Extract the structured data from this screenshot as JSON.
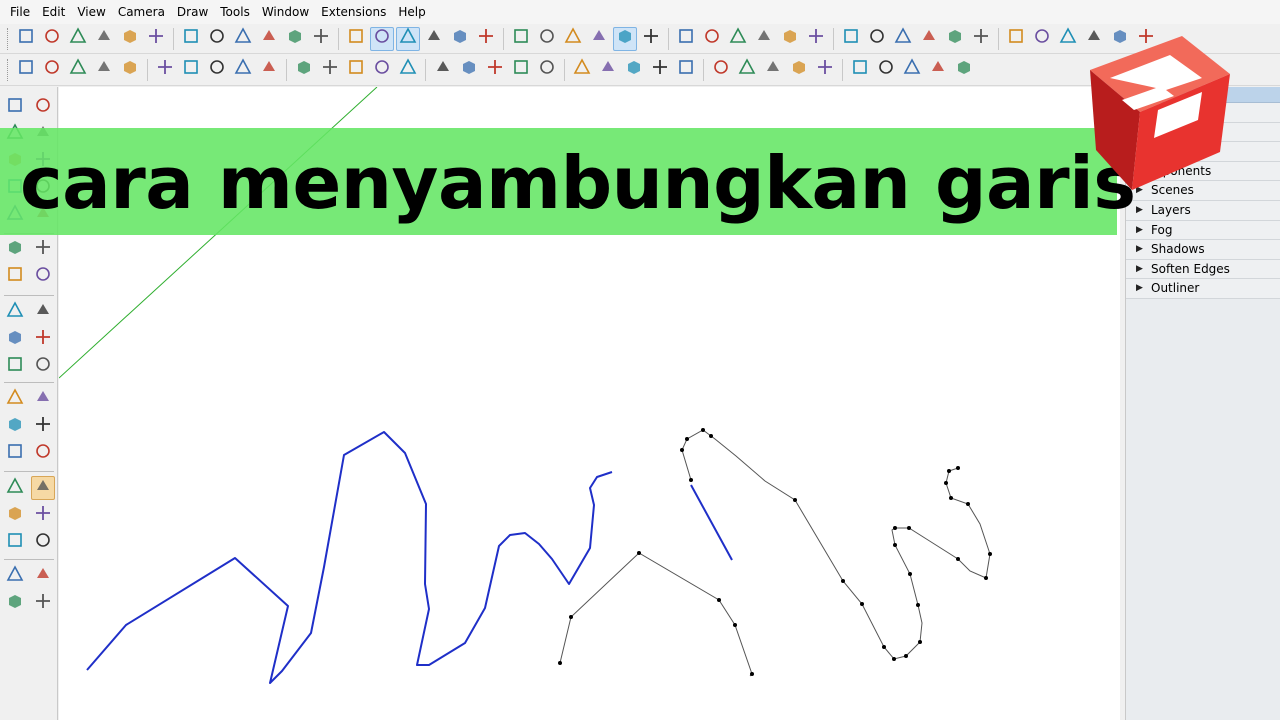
{
  "menu": [
    "File",
    "Edit",
    "View",
    "Camera",
    "Draw",
    "Tools",
    "Window",
    "Extensions",
    "Help"
  ],
  "banner": {
    "title": "cara menyambungkan garis"
  },
  "tray": {
    "items": [
      {
        "label": "Components",
        "visible_text": "mponents"
      },
      {
        "label": "Scenes"
      },
      {
        "label": "Layers"
      },
      {
        "label": "Fog"
      },
      {
        "label": "Shadows"
      },
      {
        "label": "Soften Edges"
      },
      {
        "label": "Outliner"
      }
    ]
  },
  "colors": {
    "banner": "#64e664",
    "blue_line": "#1f2fc8",
    "black_line": "#111111",
    "green_axis": "#2fae2f",
    "logo_red": "#e8332f"
  },
  "toolbar1_icons": [
    "new-icon",
    "open-icon",
    "save-icon",
    "cut-icon",
    "copy-icon",
    "paste-icon",
    "erase-icon",
    "undo-icon",
    "redo-icon",
    "print-icon",
    "model-info-icon",
    "move-icon",
    "push-pull-icon",
    "rotate-icon",
    "offset-icon",
    "iso-view-icon",
    "top-view-icon",
    "front-view-icon",
    "right-view-icon",
    "back-view-icon",
    "left-view-icon",
    "xray-icon",
    "wireframe-icon",
    "hidden-line-icon",
    "shaded-icon",
    "shaded-textures-icon",
    "warehouse-icon",
    "share-model-icon",
    "home-icon",
    "component-icon",
    "house-icon",
    "extension-icon",
    "layer-icon",
    "section-plane-icon",
    "section-display-icon",
    "section-cut-icon",
    "match-photo-icon",
    "sandbox-icon",
    "axes-icon",
    "dimension-icon",
    "protractor-icon",
    "help-icon"
  ],
  "toolbar2_icons": [
    "select-circle-icon",
    "teapot-icon",
    "hand-icon",
    "terrain-icon",
    "stamp-icon",
    "window-icon",
    "window2-icon",
    "window3-icon",
    "lock-icon",
    "measure-icon",
    "circle-target-icon",
    "triangle-icon",
    "t-square-icon",
    "sparkle-icon",
    "helmet-icon",
    "globe-icon",
    "car-icon",
    "cube1-icon",
    "cube2-icon",
    "grass-icon",
    "fog-icon",
    "group-icon",
    "box1-icon",
    "box2-icon",
    "box3-icon",
    "checker-icon",
    "disc-icon",
    "box-arrow-icon",
    "diamond-icon",
    "roof-icon",
    "ridge-icon",
    "kink-icon",
    "wave-icon",
    "pencil-line-icon",
    "ruler-icon"
  ],
  "left_tools": [
    [
      "select-arrow-icon",
      "make-component-icon"
    ],
    [
      "paint-bucket-icon",
      "eraser-icon"
    ],
    [
      "line-icon",
      "freehand-icon"
    ],
    [
      "rectangle-icon",
      "rotated-rectangle-icon"
    ],
    [
      "circle-icon",
      "polygon-icon"
    ],
    [
      "arc-icon",
      "two-point-arc-icon"
    ],
    [
      "three-point-arc-icon",
      "pie-icon"
    ],
    [
      "move-icon",
      "push-pull-icon"
    ],
    [
      "rotate-icon",
      "follow-me-icon"
    ],
    [
      "scale-icon",
      "offset-icon"
    ],
    [
      "tape-measure-icon",
      "dimension-icon"
    ],
    [
      "protractor-icon",
      "text-icon"
    ],
    [
      "axes-icon",
      "3d-text-icon"
    ],
    [
      "orbit-icon",
      "pan-icon"
    ],
    [
      "zoom-icon",
      "zoom-window-icon"
    ],
    [
      "zoom-extents-icon",
      "previous-view-icon"
    ],
    [
      "position-camera-icon",
      "look-around-icon"
    ],
    [
      "walk-icon",
      "section-plane-icon"
    ]
  ]
}
